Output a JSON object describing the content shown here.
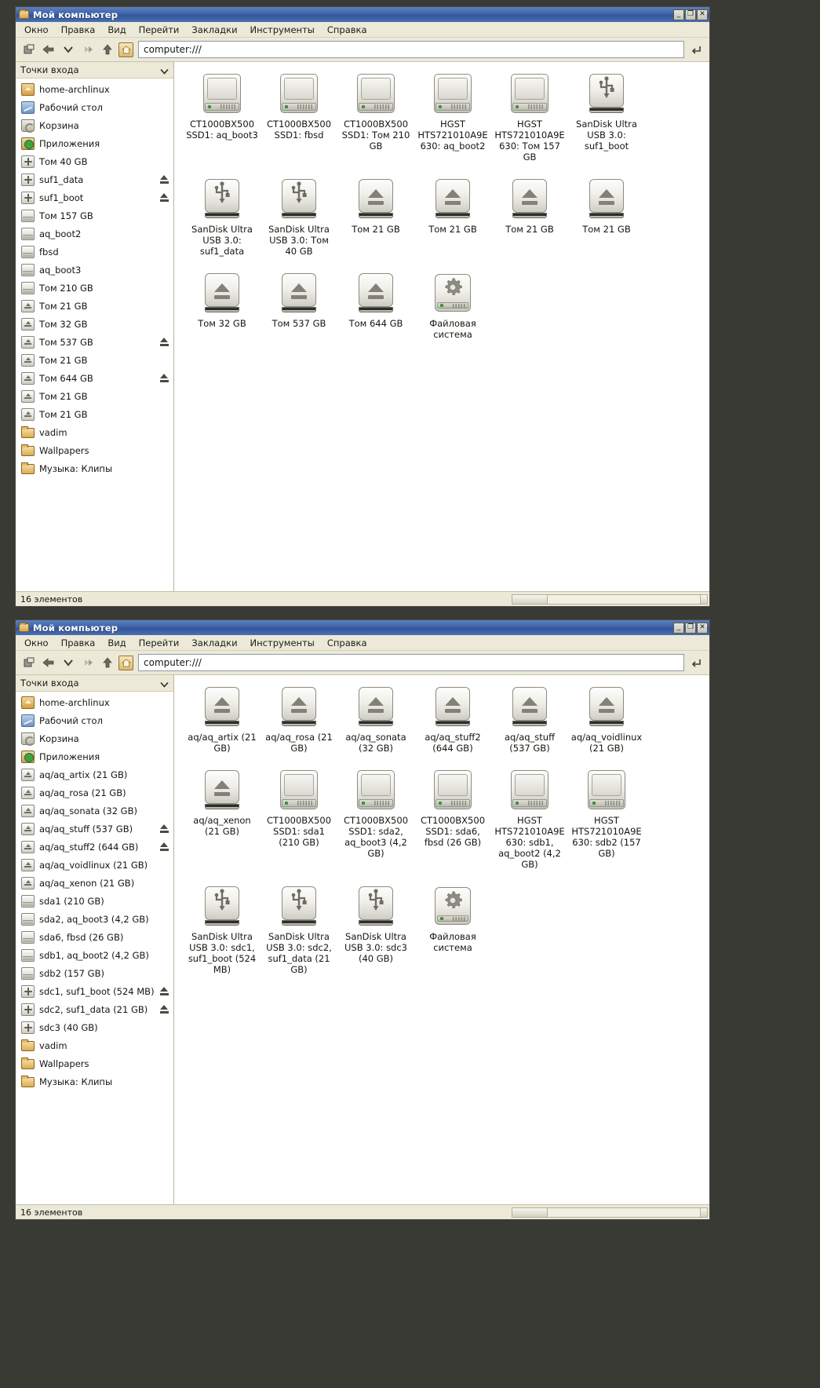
{
  "window1": {
    "title": "Мой компьютер",
    "window_buttons": {
      "minimize": "_",
      "maximize": "❐",
      "close": "✕"
    },
    "menu": [
      "Окно",
      "Правка",
      "Вид",
      "Перейти",
      "Закладки",
      "Инструменты",
      "Справка"
    ],
    "toolbar": {
      "url_value": "computer:///",
      "url_placeholder": "computer:///"
    },
    "sidebar": {
      "header": "Точки входа",
      "items": [
        {
          "label": "home-archlinux",
          "icon": "home-icon",
          "eject": false
        },
        {
          "label": "Рабочий стол",
          "icon": "desktop-icon",
          "eject": false
        },
        {
          "label": "Корзина",
          "icon": "trash-icon",
          "eject": false
        },
        {
          "label": "Приложения",
          "icon": "applications-icon",
          "eject": false
        },
        {
          "label": "Том 40 GB",
          "icon": "usb-icon",
          "eject": false
        },
        {
          "label": "suf1_data",
          "icon": "usb-icon",
          "eject": true
        },
        {
          "label": "suf1_boot",
          "icon": "usb-icon",
          "eject": true
        },
        {
          "label": "Том 157 GB",
          "icon": "harddisk-icon",
          "eject": false
        },
        {
          "label": "aq_boot2",
          "icon": "harddisk-icon",
          "eject": false
        },
        {
          "label": "fbsd",
          "icon": "harddisk-icon",
          "eject": false
        },
        {
          "label": "aq_boot3",
          "icon": "harddisk-icon",
          "eject": false
        },
        {
          "label": "Том 210 GB",
          "icon": "harddisk-icon",
          "eject": false
        },
        {
          "label": "Том 21 GB",
          "icon": "removable-icon",
          "eject": false
        },
        {
          "label": "Том 32 GB",
          "icon": "removable-icon",
          "eject": false
        },
        {
          "label": "Том 537 GB",
          "icon": "removable-icon",
          "eject": true
        },
        {
          "label": "Том 21 GB",
          "icon": "removable-icon",
          "eject": false
        },
        {
          "label": "Том 644 GB",
          "icon": "removable-icon",
          "eject": true
        },
        {
          "label": "Том 21 GB",
          "icon": "removable-icon",
          "eject": false
        },
        {
          "label": "Том 21 GB",
          "icon": "removable-icon",
          "eject": false
        },
        {
          "label": "vadim",
          "icon": "folder-icon",
          "eject": false
        },
        {
          "label": "Wallpapers",
          "icon": "folder-icon",
          "eject": false
        },
        {
          "label": "Музыка: Клипы",
          "icon": "folder-icon",
          "eject": false
        }
      ]
    },
    "icons": [
      {
        "label": "CT1000BX500 SSD1: aq_boot3",
        "icon": "harddisk-icon"
      },
      {
        "label": "CT1000BX500 SSD1: fbsd",
        "icon": "harddisk-icon"
      },
      {
        "label": "CT1000BX500 SSD1: Том 210 GB",
        "icon": "harddisk-icon"
      },
      {
        "label": "HGST HTS721010A9E630: aq_boot2",
        "icon": "harddisk-icon"
      },
      {
        "label": "HGST HTS721010A9E630: Том 157 GB",
        "icon": "harddisk-icon"
      },
      {
        "label": "SanDisk Ultra USB 3.0: suf1_boot",
        "icon": "usb-icon"
      },
      {
        "label": "SanDisk Ultra USB 3.0: suf1_data",
        "icon": "usb-icon"
      },
      {
        "label": "SanDisk Ultra USB 3.0: Том 40 GB",
        "icon": "usb-icon"
      },
      {
        "label": "Том 21 GB",
        "icon": "removable-icon"
      },
      {
        "label": "Том 21 GB",
        "icon": "removable-icon"
      },
      {
        "label": "Том 21 GB",
        "icon": "removable-icon"
      },
      {
        "label": "Том 21 GB",
        "icon": "removable-icon"
      },
      {
        "label": "Том 32 GB",
        "icon": "removable-icon"
      },
      {
        "label": "Том 537 GB",
        "icon": "removable-icon"
      },
      {
        "label": "Том 644 GB",
        "icon": "removable-icon"
      },
      {
        "label": "Файловая система",
        "icon": "filesystem-icon"
      }
    ],
    "statusbar": {
      "text": "16 элементов"
    }
  },
  "window2": {
    "title": "Мой компьютер",
    "window_buttons": {
      "minimize": "_",
      "maximize": "❐",
      "close": "✕"
    },
    "menu": [
      "Окно",
      "Правка",
      "Вид",
      "Перейти",
      "Закладки",
      "Инструменты",
      "Справка"
    ],
    "toolbar": {
      "url_value": "computer:///",
      "url_placeholder": "computer:///"
    },
    "sidebar": {
      "header": "Точки входа",
      "items": [
        {
          "label": "home-archlinux",
          "icon": "home-icon",
          "eject": false
        },
        {
          "label": "Рабочий стол",
          "icon": "desktop-icon",
          "eject": false
        },
        {
          "label": "Корзина",
          "icon": "trash-icon",
          "eject": false
        },
        {
          "label": "Приложения",
          "icon": "applications-icon",
          "eject": false
        },
        {
          "label": "aq/aq_artix (21 GB)",
          "icon": "removable-icon",
          "eject": false
        },
        {
          "label": "aq/aq_rosa (21 GB)",
          "icon": "removable-icon",
          "eject": false
        },
        {
          "label": "aq/aq_sonata (32 GB)",
          "icon": "removable-icon",
          "eject": false
        },
        {
          "label": "aq/aq_stuff (537 GB)",
          "icon": "removable-icon",
          "eject": true
        },
        {
          "label": "aq/aq_stuff2 (644 GB)",
          "icon": "removable-icon",
          "eject": true
        },
        {
          "label": "aq/aq_voidlinux (21 GB)",
          "icon": "removable-icon",
          "eject": false
        },
        {
          "label": "aq/aq_xenon (21 GB)",
          "icon": "removable-icon",
          "eject": false
        },
        {
          "label": "sda1 (210 GB)",
          "icon": "harddisk-icon",
          "eject": false
        },
        {
          "label": "sda2, aq_boot3 (4,2 GB)",
          "icon": "harddisk-icon",
          "eject": false
        },
        {
          "label": "sda6, fbsd (26 GB)",
          "icon": "harddisk-icon",
          "eject": false
        },
        {
          "label": "sdb1, aq_boot2 (4,2 GB)",
          "icon": "harddisk-icon",
          "eject": false
        },
        {
          "label": "sdb2 (157 GB)",
          "icon": "harddisk-icon",
          "eject": false
        },
        {
          "label": "sdc1, suf1_boot (524 MB)",
          "icon": "usb-icon",
          "eject": true
        },
        {
          "label": "sdc2, suf1_data (21 GB)",
          "icon": "usb-icon",
          "eject": true
        },
        {
          "label": "sdc3 (40 GB)",
          "icon": "usb-icon",
          "eject": false
        },
        {
          "label": "vadim",
          "icon": "folder-icon",
          "eject": false
        },
        {
          "label": "Wallpapers",
          "icon": "folder-icon",
          "eject": false
        },
        {
          "label": "Музыка: Клипы",
          "icon": "folder-icon",
          "eject": false
        }
      ]
    },
    "icons": [
      {
        "label": "aq/aq_artix (21 GB)",
        "icon": "removable-icon"
      },
      {
        "label": "aq/aq_rosa (21 GB)",
        "icon": "removable-icon"
      },
      {
        "label": "aq/aq_sonata (32 GB)",
        "icon": "removable-icon"
      },
      {
        "label": "aq/aq_stuff2 (644 GB)",
        "icon": "removable-icon"
      },
      {
        "label": "aq/aq_stuff (537 GB)",
        "icon": "removable-icon"
      },
      {
        "label": "aq/aq_voidlinux (21 GB)",
        "icon": "removable-icon"
      },
      {
        "label": "aq/aq_xenon (21 GB)",
        "icon": "removable-icon"
      },
      {
        "label": "CT1000BX500 SSD1: sda1 (210 GB)",
        "icon": "harddisk-icon"
      },
      {
        "label": "CT1000BX500 SSD1: sda2, aq_boot3 (4,2 GB)",
        "icon": "harddisk-icon"
      },
      {
        "label": "CT1000BX500 SSD1: sda6, fbsd (26 GB)",
        "icon": "harddisk-icon"
      },
      {
        "label": "HGST HTS721010A9E630: sdb1, aq_boot2 (4,2 GB)",
        "icon": "harddisk-icon"
      },
      {
        "label": "HGST HTS721010A9E630: sdb2 (157 GB)",
        "icon": "harddisk-icon"
      },
      {
        "label": "SanDisk Ultra USB 3.0: sdc1, suf1_boot (524 MB)",
        "icon": "usb-icon"
      },
      {
        "label": "SanDisk Ultra USB 3.0: sdc2, suf1_data (21 GB)",
        "icon": "usb-icon"
      },
      {
        "label": "SanDisk Ultra USB 3.0: sdc3 (40 GB)",
        "icon": "usb-icon"
      },
      {
        "label": "Файловая система",
        "icon": "filesystem-icon"
      }
    ],
    "statusbar": {
      "text": "16 элементов"
    }
  },
  "theme": {
    "titlebar_active": "#3f63a8",
    "chrome_bg": "#ece9d8",
    "view_bg": "#ffffff",
    "text": "#15150f",
    "led_green": "#3ec23e",
    "desktop_bg": "#3a3a34"
  }
}
